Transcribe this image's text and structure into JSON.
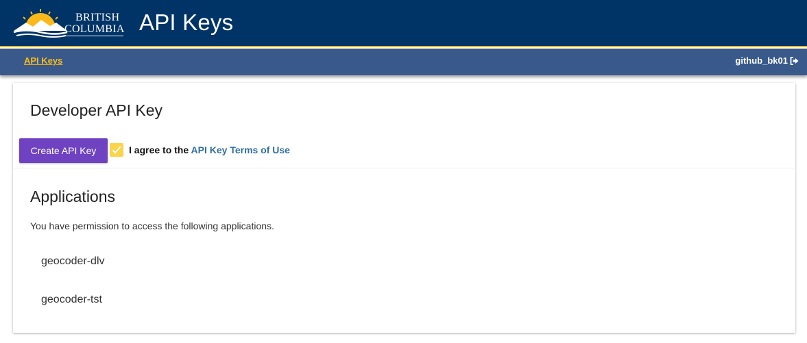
{
  "header": {
    "logo": {
      "line1": "BRITISH",
      "line2": "COLUMBIA",
      "icon": "bc-sun-logo-icon"
    },
    "title": "API Keys"
  },
  "navbar": {
    "link": "API Keys",
    "username": "github_bk01",
    "logout_icon": "sign-out-icon"
  },
  "developer": {
    "title": "Developer API Key",
    "create_button": "Create API Key",
    "agree_prefix": "I agree to the ",
    "terms_link": "API Key Terms of Use",
    "checkbox_checked": true
  },
  "applications": {
    "title": "Applications",
    "description": "You have permission to access the following applications.",
    "items": [
      "geocoder-dlv",
      "geocoder-tst"
    ]
  },
  "colors": {
    "header_bg": "#003366",
    "nav_bg": "#38598a",
    "accent_gold": "#fcba19",
    "button_purple": "#6f42c1",
    "link_blue": "#2f6fa5"
  }
}
